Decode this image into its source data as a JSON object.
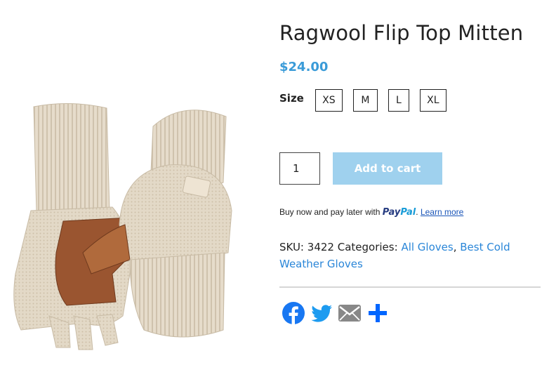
{
  "product": {
    "title": "Ragwool Flip Top Mitten",
    "price": "$24.00",
    "image_alt": "Ragwool Flip Top Mitten"
  },
  "size": {
    "label": "Size",
    "options": [
      "XS",
      "M",
      "L",
      "XL"
    ]
  },
  "cart": {
    "quantity": "1",
    "add_label": "Add to cart"
  },
  "paypal": {
    "prefix": "Buy now and pay later with",
    "logo_pay": "Pay",
    "logo_pal": "Pal",
    "suffix": ".",
    "learn_more": "Learn more"
  },
  "meta": {
    "sku_label": "SKU:",
    "sku": "3422",
    "categories_label": "Categories:",
    "categories": [
      "All Gloves",
      "Best Cold Weather Gloves"
    ],
    "separator": ","
  },
  "share": {
    "networks": [
      "facebook-icon",
      "twitter-icon",
      "email-icon",
      "share-icon"
    ]
  },
  "colors": {
    "price": "#3a9bd8",
    "add_to_cart": "#9fd1ee",
    "link": "#2a86d8",
    "facebook": "#1877f2",
    "twitter": "#1d9bf0",
    "email": "#888888",
    "share": "#0166ff"
  }
}
